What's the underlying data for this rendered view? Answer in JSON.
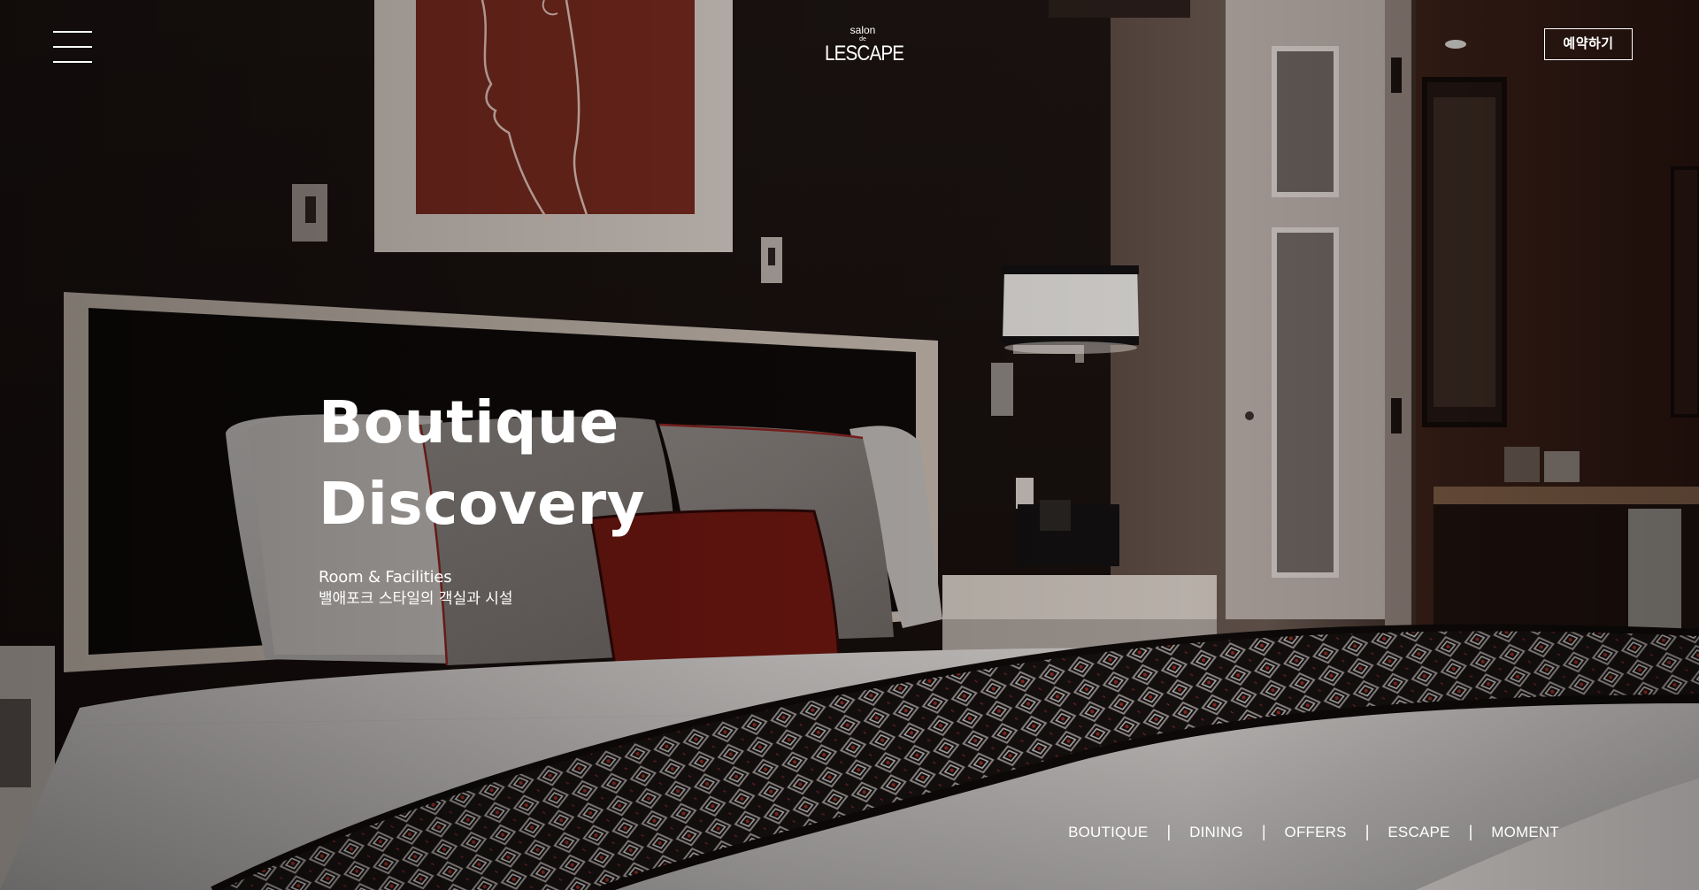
{
  "header": {
    "menu_icon": "hamburger-menu-icon",
    "logo": {
      "top": "salon",
      "de": "de",
      "main": "LESCAPE"
    },
    "reserve_label": "예약하기"
  },
  "hero": {
    "title_line1": "Boutique",
    "title_line2": "Discovery",
    "subtitle_en": "Room & Facilities",
    "subtitle_ko": "밸애포크 스타일의 객실과 시설"
  },
  "bottom_nav": {
    "items": [
      {
        "label": "BOUTIQUE"
      },
      {
        "label": "DINING"
      },
      {
        "label": "OFFERS"
      },
      {
        "label": "ESCAPE"
      },
      {
        "label": "MOMENT"
      }
    ],
    "separator": "|"
  },
  "colors": {
    "text": "#ffffff",
    "wall_dark": "#1c1210",
    "art_red": "#7a2a1e",
    "pillow_red": "#7e1a12",
    "bed_white": "#d9d6d4"
  }
}
